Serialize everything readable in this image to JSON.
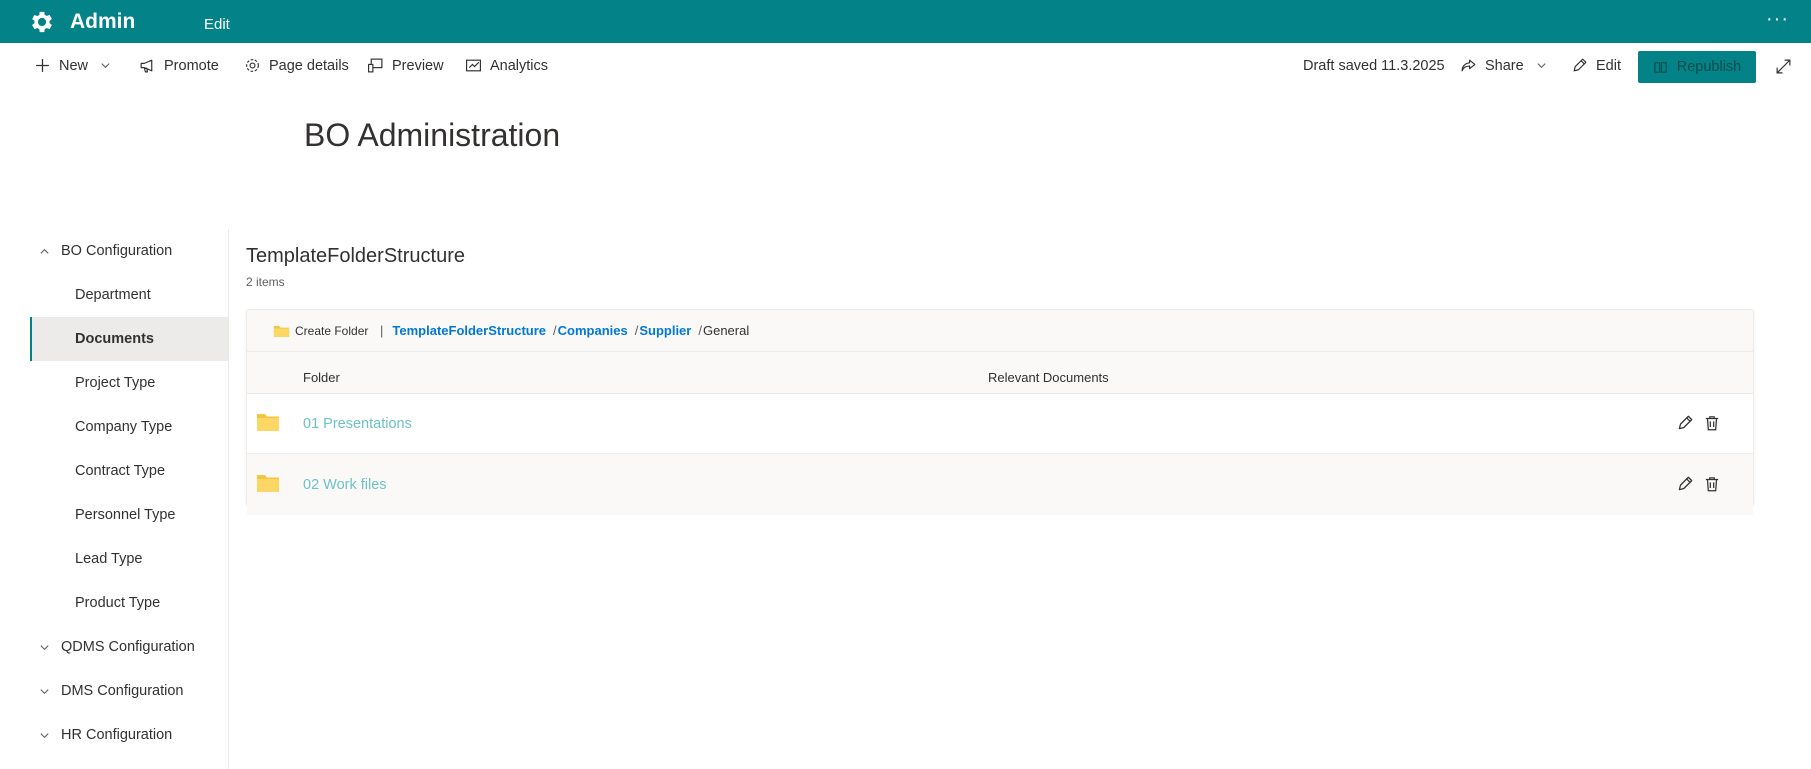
{
  "suite_bar": {
    "title": "Admin",
    "edit_label": "Edit",
    "more_label": "···",
    "color": "#038387"
  },
  "command_bar": {
    "new_label": "New",
    "promote_label": "Promote",
    "page_details_label": "Page details",
    "preview_label": "Preview",
    "analytics_label": "Analytics",
    "draft_status": "Draft saved 11.3.2025",
    "share_label": "Share",
    "edit_label": "Edit",
    "republish_label": "Republish"
  },
  "page": {
    "title": "BO Administration"
  },
  "left_nav": {
    "items": [
      {
        "label": "BO Configuration",
        "type": "group",
        "expanded": true
      },
      {
        "label": "Department",
        "type": "item"
      },
      {
        "label": "Documents",
        "type": "item",
        "active": true
      },
      {
        "label": "Project Type",
        "type": "item"
      },
      {
        "label": "Company Type",
        "type": "item"
      },
      {
        "label": "Contract Type",
        "type": "item"
      },
      {
        "label": "Personnel Type",
        "type": "item"
      },
      {
        "label": "Lead Type",
        "type": "item"
      },
      {
        "label": "Product Type",
        "type": "item"
      },
      {
        "label": "QDMS Configuration",
        "type": "group",
        "expanded": false
      },
      {
        "label": "DMS Configuration",
        "type": "group",
        "expanded": false
      },
      {
        "label": "HR Configuration",
        "type": "group",
        "expanded": false
      }
    ]
  },
  "list": {
    "title": "TemplateFolderStructure",
    "count": "2 items",
    "create_folder_label": "Create Folder",
    "breadcrumb": {
      "pipe": "|",
      "separator": "/",
      "links": [
        "TemplateFolderStructure",
        "Companies",
        "Supplier"
      ],
      "current": "General"
    },
    "columns": {
      "folder": "Folder",
      "relevant_documents": "Relevant Documents"
    },
    "rows": [
      {
        "name": "01 Presentations"
      },
      {
        "name": "02 Work files"
      }
    ]
  },
  "colors": {
    "accent": "#038387",
    "link": "#0078d4",
    "folder_link": "#6cc3c6",
    "folder_icon": "#f4c542"
  }
}
